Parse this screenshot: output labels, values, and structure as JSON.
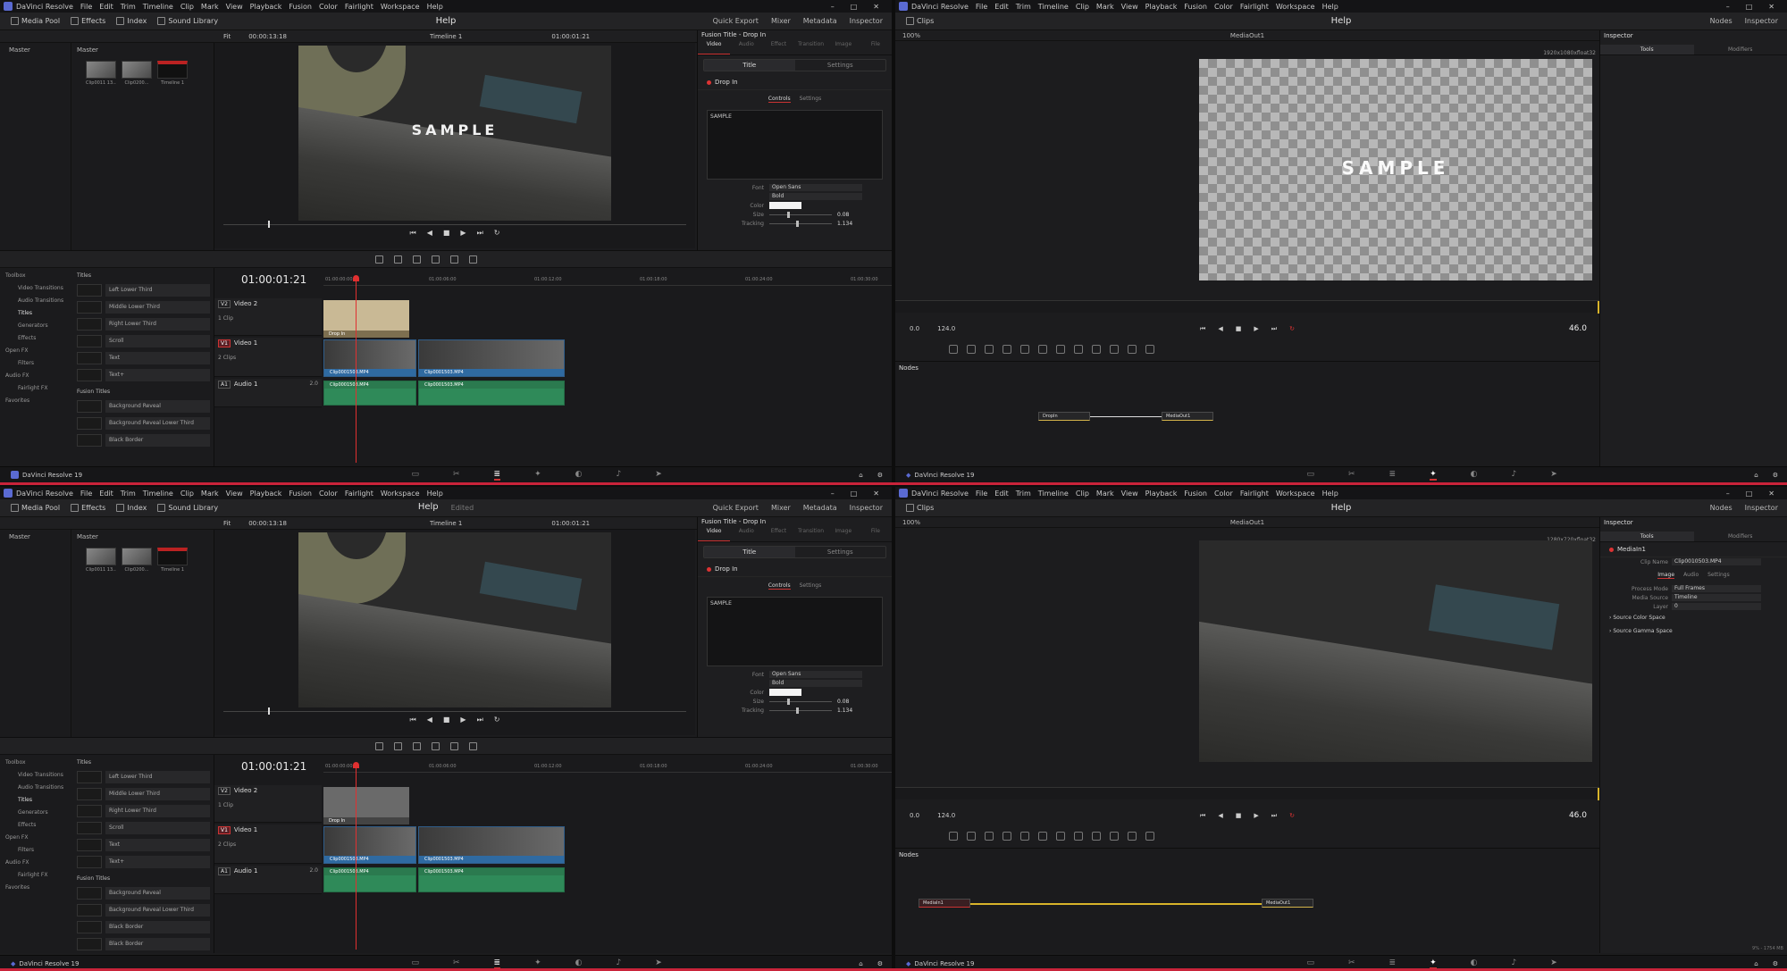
{
  "app": {
    "name": "DaVinci Resolve",
    "brand": "DaVinci Resolve 19",
    "menu": [
      "DaVinci Resolve",
      "File",
      "Edit",
      "Trim",
      "Timeline",
      "Clip",
      "Mark",
      "View",
      "Playback",
      "Fusion",
      "Color",
      "Fairlight",
      "Workspace",
      "Help"
    ]
  },
  "edit_page": {
    "toolbar": {
      "media_pool": "Media Pool",
      "effects": "Effects",
      "index": "Index",
      "sound_library": "Sound Library",
      "title": "Help",
      "title_edited": "Edited",
      "quick_export": "Quick Export",
      "mixer": "Mixer",
      "metadata": "Metadata",
      "inspector": "Inspector"
    },
    "subbar": {
      "fit": "Fit",
      "timecode_src": "00:00:13:18",
      "timeline_name": "Timeline 1",
      "timecode_rec": "01:00:01:21"
    },
    "media_pool": {
      "bin": "Master",
      "folder": "Master",
      "clips": [
        "Clip0011 13...",
        "Clip0200...",
        "Timeline 1"
      ]
    },
    "inspector": {
      "header": "Fusion Title - Drop In",
      "tabs": [
        "Video",
        "Audio",
        "Effect",
        "Transition",
        "Image",
        "File"
      ],
      "segments": [
        "Title",
        "Settings"
      ],
      "node": "Drop In",
      "control_tabs": [
        "Controls",
        "Settings"
      ],
      "text_value": "SAMPLE",
      "props": {
        "font_label": "Font",
        "font": "Open Sans",
        "style": "Bold",
        "color_label": "Color",
        "size_label": "Size",
        "size": "0.08",
        "tracking_label": "Tracking",
        "tracking": "1.134"
      }
    },
    "viewer_text": "SAMPLE",
    "timeline": {
      "timecode": "01:00:01:21",
      "ruler": [
        "01:00:00:00",
        "01:00:06:00",
        "01:00:12:00",
        "01:00:18:00",
        "01:00:24:00",
        "01:00:30:00"
      ],
      "tracks": [
        {
          "id": "V2",
          "name": "Video 2",
          "count": "1 Clip"
        },
        {
          "id": "V1",
          "name": "Video 1",
          "count": "2 Clips"
        },
        {
          "id": "A1",
          "name": "Audio 1",
          "count": "2.0"
        }
      ],
      "title_clip": "Drop In",
      "video_clips": [
        "Clip0001503.MP4",
        "Clip0001503.MP4"
      ],
      "audio_clips": [
        "Clip0001503.MP4",
        "Clip0001503.MP4"
      ]
    },
    "toolbox": {
      "items": [
        "Toolbox",
        "Video Transitions",
        "Audio Transitions",
        "Titles",
        "Generators",
        "Effects",
        "Open FX",
        "Filters",
        "Audio FX",
        "Fairlight FX",
        "Favorites"
      ],
      "titles_header": "Titles",
      "titles": [
        "Left Lower Third",
        "Middle Lower Third",
        "Right Lower Third",
        "Scroll",
        "Text",
        "Text+"
      ],
      "fusion_header": "Fusion Titles",
      "fusion_titles": [
        "Background Reveal",
        "Background Reveal Lower Third",
        "Black Border",
        "Black Border"
      ]
    }
  },
  "fusion_page": {
    "toolbar": {
      "clips": "Clips",
      "title": "Help",
      "nodes": "Nodes",
      "inspector": "Inspector"
    },
    "viewer": {
      "zoom": "100%",
      "name": "MediaOut1",
      "resolution_top": "1920x1080xfloat32",
      "resolution_bottom": "1280x720xfloat32",
      "sample": "SAMPLE"
    },
    "transport": {
      "start": "0.0",
      "end": "124.0",
      "end_bottom": "124.0",
      "frame": "46.0"
    },
    "nodes_header": "Nodes",
    "top_nodes": [
      "DropIn",
      "MediaOut1"
    ],
    "bottom_nodes": [
      "MediaIn1",
      "MediaOut1"
    ],
    "inspector": {
      "tabs": [
        "Tools",
        "Modifiers"
      ],
      "node": "MediaIn1",
      "clip_name_label": "Clip Name",
      "clip_name": "Clip0010503.MP4",
      "sub_tabs": [
        "Image",
        "Audio",
        "Settings"
      ],
      "process_mode_label": "Process Mode",
      "process_mode": "Full Frames",
      "media_source_label": "Media Source",
      "media_source": "Timeline",
      "layer_label": "Layer",
      "layer": "0",
      "sections": [
        "Source Color Space",
        "Source Gamma Space"
      ]
    },
    "status": "9% - 1754 MB"
  },
  "colors": {
    "accent": "#c9233a",
    "title_clip": "#c9b995",
    "video_clip": "#2f6aa1",
    "audio_clip": "#2f8a59",
    "wire": "#d8b42a"
  }
}
